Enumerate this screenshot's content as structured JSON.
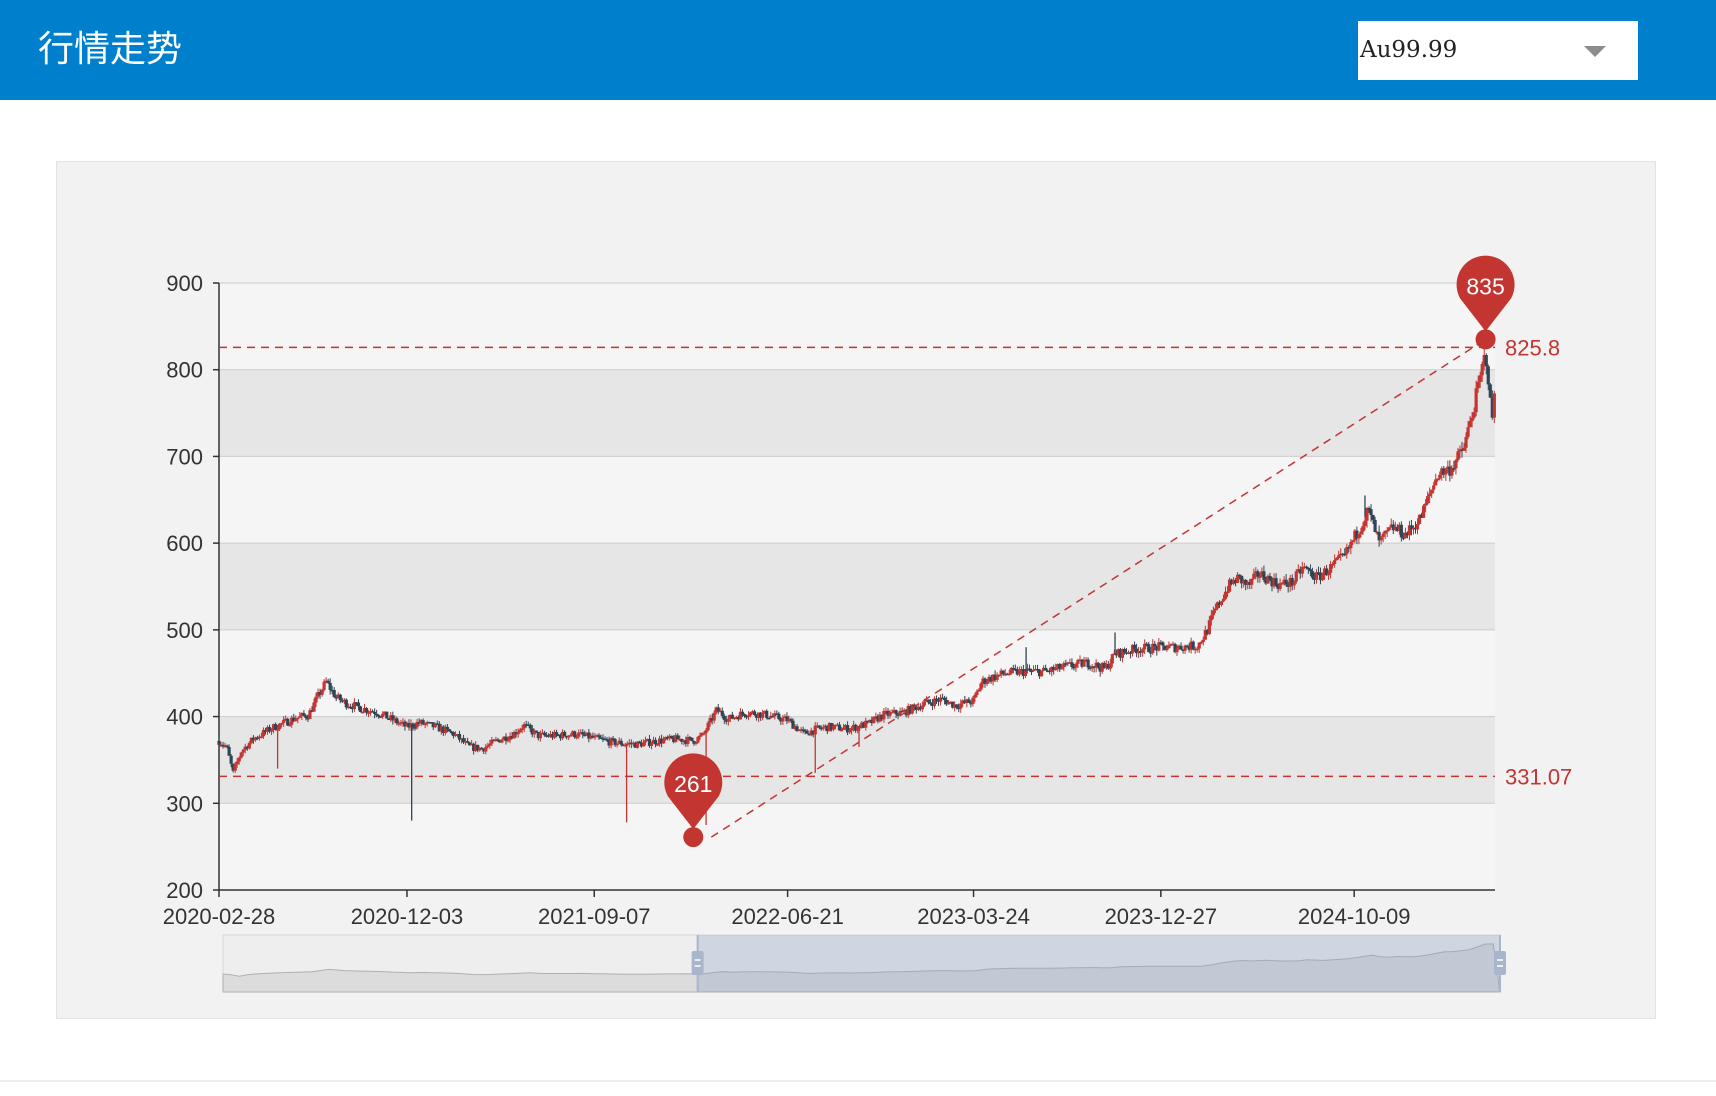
{
  "header": {
    "title": "行情走势"
  },
  "instrument_select": {
    "value": "Au99.99"
  },
  "colors": {
    "header_bg": "#0080cc",
    "up": "#c23531",
    "down": "#2f4554",
    "mark": "#c23531"
  },
  "chart_data": {
    "type": "candlestick",
    "title": "",
    "xlabel": "",
    "ylabel": "",
    "ylim": [
      200,
      900
    ],
    "y_ticks": [
      "900",
      "800",
      "700",
      "600",
      "500",
      "400",
      "300",
      "200"
    ],
    "x_ticks": [
      "2020-02-28",
      "2020-12-03",
      "2021-09-07",
      "2022-06-21",
      "2023-03-24",
      "2023-12-27",
      "2024-10-09"
    ],
    "x_range": [
      "2020-02-28",
      "2025-05-06"
    ],
    "grid": "alternating horizontal bands",
    "mark_points": [
      {
        "label": "835",
        "date": "2025-04-22",
        "value": 835,
        "kind": "max"
      },
      {
        "label": "261",
        "date": "2022-02-01",
        "value": 261,
        "kind": "min"
      }
    ],
    "mark_lines": [
      {
        "label": "825.8",
        "value": 825.8
      },
      {
        "label": "331.07",
        "value": 331.07
      }
    ],
    "trend_line": {
      "from": {
        "date": "2022-02-01",
        "value": 261
      },
      "to": {
        "date": "2025-04-22",
        "value": 835
      }
    },
    "series": [
      {
        "name": "",
        "kind": "close-price-path",
        "points": [
          [
            "2020-02-28",
            372
          ],
          [
            "2020-03-10",
            365
          ],
          [
            "2020-03-20",
            335
          ],
          [
            "2020-04-01",
            360
          ],
          [
            "2020-04-20",
            375
          ],
          [
            "2020-05-20",
            388
          ],
          [
            "2020-06-20",
            398
          ],
          [
            "2020-07-10",
            402
          ],
          [
            "2020-07-25",
            425
          ],
          [
            "2020-08-05",
            440
          ],
          [
            "2020-08-20",
            422
          ],
          [
            "2020-09-05",
            415
          ],
          [
            "2020-09-25",
            410
          ],
          [
            "2020-10-20",
            405
          ],
          [
            "2020-11-20",
            393
          ],
          [
            "2020-12-03",
            388
          ],
          [
            "2020-12-20",
            393
          ],
          [
            "2021-01-15",
            388
          ],
          [
            "2021-02-10",
            380
          ],
          [
            "2021-03-05",
            365
          ],
          [
            "2021-03-25",
            363
          ],
          [
            "2021-04-15",
            372
          ],
          [
            "2021-05-10",
            380
          ],
          [
            "2021-05-25",
            390
          ],
          [
            "2021-06-15",
            378
          ],
          [
            "2021-07-10",
            378
          ],
          [
            "2021-08-10",
            380
          ],
          [
            "2021-09-07",
            375
          ],
          [
            "2021-10-05",
            370
          ],
          [
            "2021-11-10",
            368
          ],
          [
            "2021-12-10",
            372
          ],
          [
            "2022-01-10",
            374
          ],
          [
            "2022-02-01",
            372
          ],
          [
            "2022-02-15",
            378
          ],
          [
            "2022-03-08",
            408
          ],
          [
            "2022-03-25",
            397
          ],
          [
            "2022-04-20",
            405
          ],
          [
            "2022-05-20",
            402
          ],
          [
            "2022-06-10",
            398
          ],
          [
            "2022-06-21",
            396
          ],
          [
            "2022-07-15",
            380
          ],
          [
            "2022-08-01",
            385
          ],
          [
            "2022-08-20",
            388
          ],
          [
            "2022-09-20",
            386
          ],
          [
            "2022-10-20",
            392
          ],
          [
            "2022-11-10",
            402
          ],
          [
            "2022-12-10",
            405
          ],
          [
            "2023-01-10",
            415
          ],
          [
            "2023-02-05",
            420
          ],
          [
            "2023-02-25",
            413
          ],
          [
            "2023-03-24",
            418
          ],
          [
            "2023-04-05",
            440
          ],
          [
            "2023-04-20",
            445
          ],
          [
            "2023-05-10",
            450
          ],
          [
            "2023-06-10",
            452
          ],
          [
            "2023-07-10",
            452
          ],
          [
            "2023-08-10",
            458
          ],
          [
            "2023-09-10",
            462
          ],
          [
            "2023-10-05",
            455
          ],
          [
            "2023-10-20",
            472
          ],
          [
            "2023-11-20",
            478
          ],
          [
            "2023-12-27",
            480
          ],
          [
            "2024-01-20",
            480
          ],
          [
            "2024-02-20",
            482
          ],
          [
            "2024-03-05",
            500
          ],
          [
            "2024-03-15",
            520
          ],
          [
            "2024-04-05",
            550
          ],
          [
            "2024-04-20",
            560
          ],
          [
            "2024-05-05",
            550
          ],
          [
            "2024-05-20",
            565
          ],
          [
            "2024-06-20",
            552
          ],
          [
            "2024-07-10",
            555
          ],
          [
            "2024-07-25",
            572
          ],
          [
            "2024-08-15",
            560
          ],
          [
            "2024-09-05",
            572
          ],
          [
            "2024-09-25",
            585
          ],
          [
            "2024-10-15",
            615
          ],
          [
            "2024-10-30",
            638
          ],
          [
            "2024-11-15",
            600
          ],
          [
            "2024-12-05",
            618
          ],
          [
            "2024-12-25",
            610
          ],
          [
            "2025-01-15",
            628
          ],
          [
            "2025-02-10",
            680
          ],
          [
            "2025-03-01",
            686
          ],
          [
            "2025-03-20",
            708
          ],
          [
            "2025-04-01",
            745
          ],
          [
            "2025-04-14",
            790
          ],
          [
            "2025-04-22",
            820
          ],
          [
            "2025-04-26",
            790
          ],
          [
            "2025-05-01",
            740
          ],
          [
            "2025-05-06",
            775
          ]
        ]
      }
    ],
    "range_slider": {
      "start": "2022-02-01",
      "end": "2025-05-06"
    }
  }
}
